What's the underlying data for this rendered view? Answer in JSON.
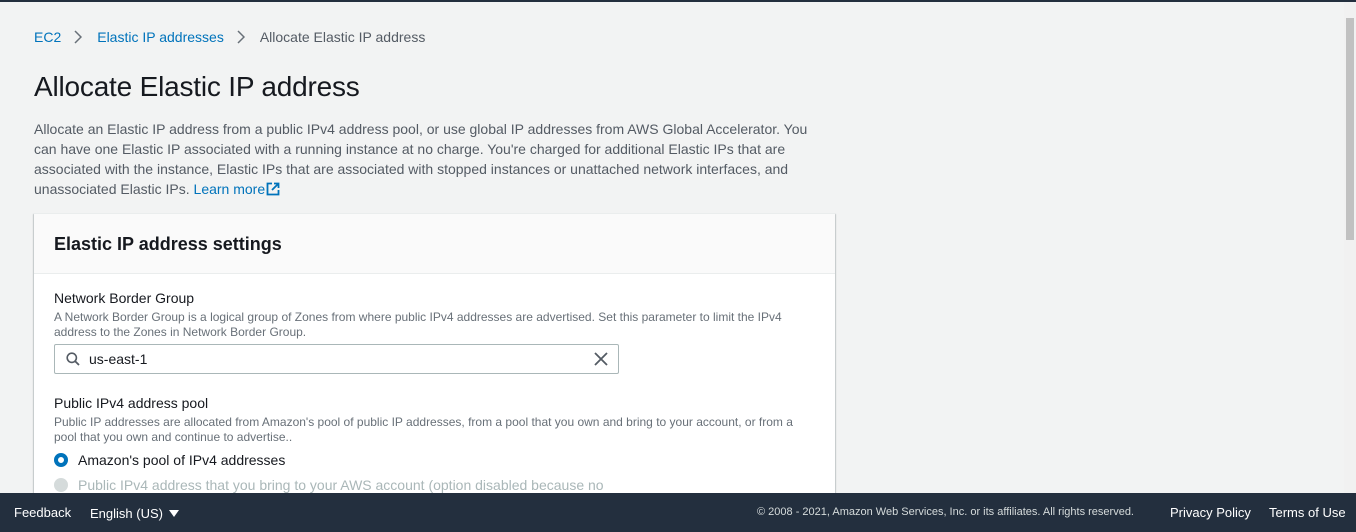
{
  "breadcrumb": {
    "items": [
      "EC2",
      "Elastic IP addresses"
    ],
    "current": "Allocate Elastic IP address"
  },
  "page": {
    "title": "Allocate Elastic IP address",
    "description": "Allocate an Elastic IP address from a public IPv4 address pool, or use global IP addresses from AWS Global Accelerator. You can have one Elastic IP associated with a running instance at no charge. You're charged for additional Elastic IPs that are associated with the instance, Elastic IPs that are associated with stopped instances or unattached network interfaces, and unassociated Elastic IPs.",
    "learn_more": "Learn more"
  },
  "panel": {
    "title": "Elastic IP address settings",
    "network_border_group": {
      "label": "Network Border Group",
      "description": "A Network Border Group is a logical group of Zones from where public IPv4 addresses are advertised. Set this parameter to limit the IPv4 address to the Zones in Network Border Group.",
      "value": "us-east-1"
    },
    "ipv4_pool": {
      "label": "Public IPv4 address pool",
      "description": "Public IP addresses are allocated from Amazon's pool of public IP addresses, from a pool that you own and bring to your account, or from a pool that you own and continue to advertise..",
      "options": [
        {
          "label": "Amazon's pool of IPv4 addresses",
          "checked": true,
          "disabled": false
        },
        {
          "label": "Public IPv4 address that you bring to your AWS account (option disabled because no",
          "checked": false,
          "disabled": true
        }
      ]
    }
  },
  "footer": {
    "feedback": "Feedback",
    "language": "English (US)",
    "copyright": "© 2008 - 2021, Amazon Web Services, Inc. or its affiliates. All rights reserved.",
    "privacy": "Privacy Policy",
    "terms": "Terms of Use"
  },
  "colors": {
    "link": "#0073bb",
    "footer_bg": "#232f3e",
    "page_bg": "#f2f3f3"
  }
}
